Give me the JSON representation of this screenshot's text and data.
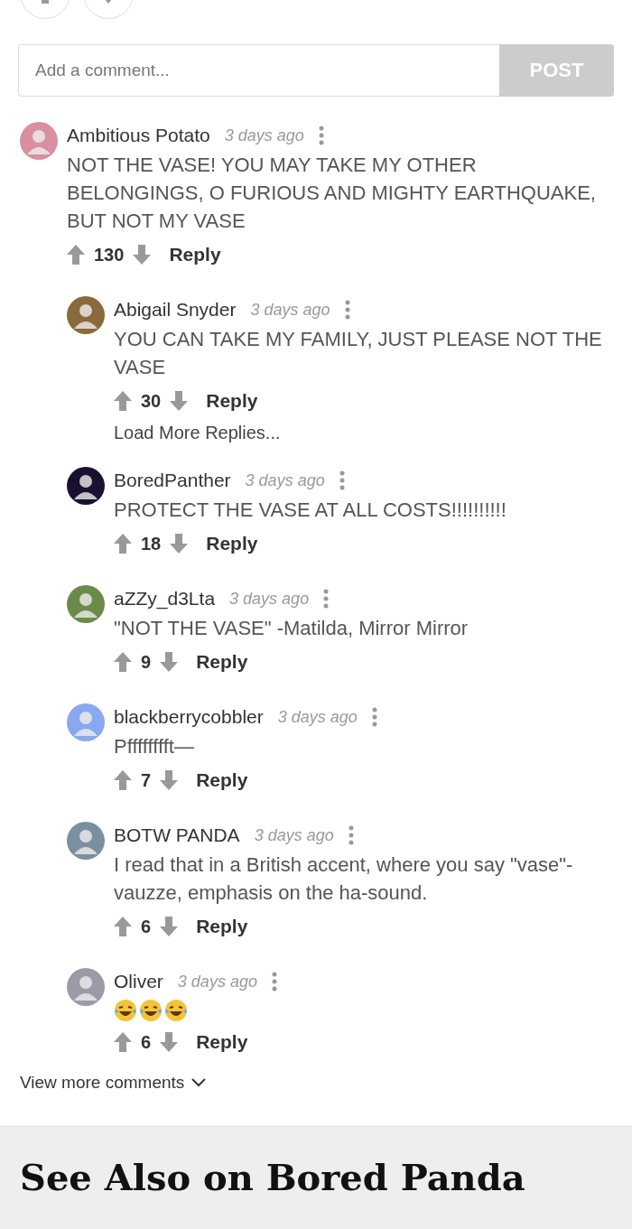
{
  "comment_box": {
    "placeholder": "Add a comment...",
    "button": "POST"
  },
  "comments": [
    {
      "author": "Ambitious Potato",
      "time": "3 days ago",
      "body": "NOT THE VASE! YOU MAY TAKE MY OTHER BELONGINGS, O FURIOUS AND MIGHTY EARTHQUAKE, BUT NOT MY VASE",
      "votes": "130",
      "reply": "Reply",
      "children": [
        {
          "author": "Abigail Snyder",
          "time": "3 days ago",
          "body": "YOU CAN TAKE MY FAMILY, JUST PLEASE NOT THE VASE",
          "votes": "30",
          "reply": "Reply",
          "load_more": "Load More Replies..."
        },
        {
          "author": "BoredPanther",
          "time": "3 days ago",
          "body": "PROTECT THE VASE AT ALL COSTS!!!!!!!!!!",
          "votes": "18",
          "reply": "Reply"
        },
        {
          "author": "aZZy_d3Lta",
          "time": "3 days ago",
          "body": "\"NOT THE VASE\" -Matilda, Mirror Mirror",
          "votes": "9",
          "reply": "Reply"
        },
        {
          "author": "blackberrycobbler",
          "time": "3 days ago",
          "body": "Pfffffffft—",
          "votes": "7",
          "reply": "Reply"
        },
        {
          "author": "BOTW PANDA",
          "time": "3 days ago",
          "body": "I read that in a British accent, where you say \"vase\"-vauzze, emphasis on the ha-sound.",
          "votes": "6",
          "reply": "Reply"
        },
        {
          "author": "Oliver",
          "time": "3 days ago",
          "emojis": [
            {
              "kind": "laugh"
            },
            {
              "kind": "laugh"
            },
            {
              "kind": "laugh"
            }
          ],
          "votes": "6",
          "reply": "Reply"
        }
      ]
    }
  ],
  "view_more": "View more comments",
  "see_also": {
    "title": "See Also on Bored Panda"
  }
}
